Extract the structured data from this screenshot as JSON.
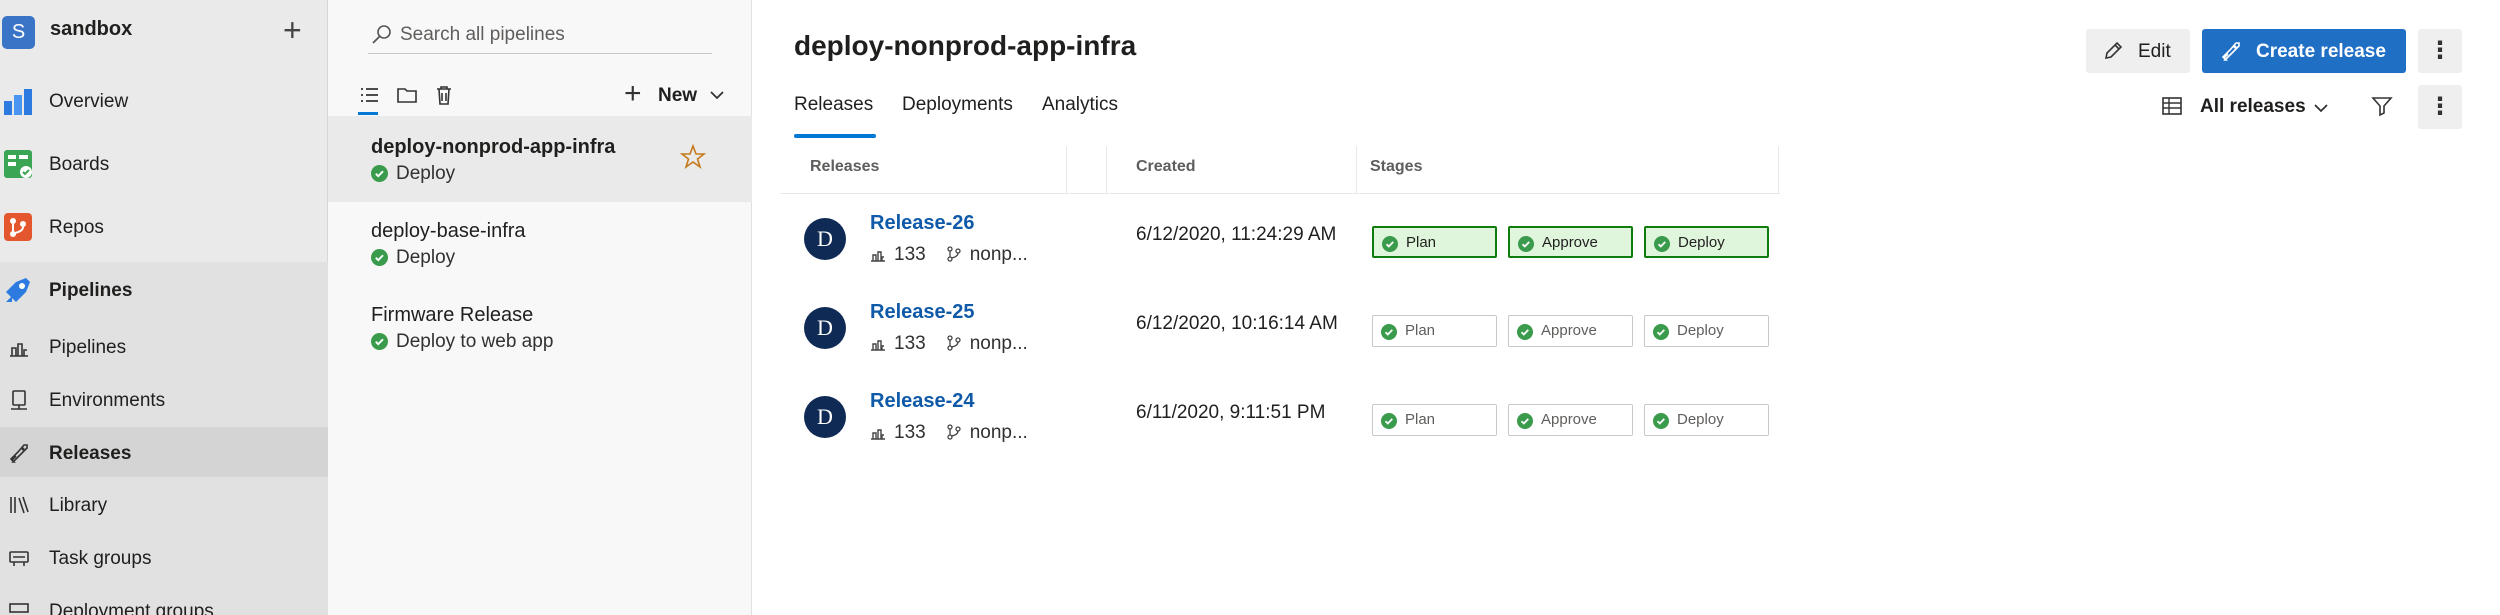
{
  "org": {
    "initial": "S",
    "name": "sandbox",
    "add_icon": "plus-icon"
  },
  "nav": {
    "items": [
      {
        "label": "Overview",
        "icon": "overview-icon"
      },
      {
        "label": "Boards",
        "icon": "boards-icon"
      },
      {
        "label": "Repos",
        "icon": "repos-icon"
      },
      {
        "label": "Pipelines",
        "icon": "pipelines-icon"
      }
    ],
    "sub_items": [
      {
        "label": "Pipelines",
        "icon": "pipelines-sub-icon"
      },
      {
        "label": "Environments",
        "icon": "environments-icon"
      },
      {
        "label": "Releases",
        "icon": "releases-icon"
      },
      {
        "label": "Library",
        "icon": "library-icon"
      },
      {
        "label": "Task groups",
        "icon": "task-groups-icon"
      },
      {
        "label": "Deployment groups",
        "icon": "deployment-groups-icon"
      }
    ]
  },
  "list": {
    "search_placeholder": "Search all pipelines",
    "new_label": "New",
    "pipelines": [
      {
        "name": "deploy-nonprod-app-infra",
        "status": "Deploy",
        "selected": true
      },
      {
        "name": "deploy-base-infra",
        "status": "Deploy",
        "selected": false
      },
      {
        "name": "Firmware Release",
        "status": "Deploy to web app",
        "selected": false
      }
    ]
  },
  "main": {
    "title": "deploy-nonprod-app-infra",
    "tabs": [
      {
        "label": "Releases",
        "active": true
      },
      {
        "label": "Deployments",
        "active": false
      },
      {
        "label": "Analytics",
        "active": false
      }
    ],
    "edit_label": "Edit",
    "create_label": "Create release",
    "filter_label": "All releases",
    "table": {
      "headers": {
        "releases": "Releases",
        "created": "Created",
        "stages": "Stages"
      },
      "rows": [
        {
          "avatar": "D",
          "name": "Release-26",
          "build": "133",
          "branch": "nonp...",
          "created": "6/12/2020, 11:24:29 AM",
          "stages": [
            {
              "label": "Plan",
              "highlighted": true
            },
            {
              "label": "Approve",
              "highlighted": true
            },
            {
              "label": "Deploy",
              "highlighted": true
            }
          ]
        },
        {
          "avatar": "D",
          "name": "Release-25",
          "build": "133",
          "branch": "nonp...",
          "created": "6/12/2020, 10:16:14 AM",
          "stages": [
            {
              "label": "Plan",
              "highlighted": false
            },
            {
              "label": "Approve",
              "highlighted": false
            },
            {
              "label": "Deploy",
              "highlighted": false
            }
          ]
        },
        {
          "avatar": "D",
          "name": "Release-24",
          "build": "133",
          "branch": "nonp...",
          "created": "6/11/2020, 9:11:51 PM",
          "stages": [
            {
              "label": "Plan",
              "highlighted": false
            },
            {
              "label": "Approve",
              "highlighted": false
            },
            {
              "label": "Deploy",
              "highlighted": false
            }
          ]
        }
      ]
    }
  },
  "colors": {
    "accent": "#0078d4",
    "primary_button": "#1f6fc5",
    "success": "#107c10",
    "link": "#0f5aa8"
  }
}
